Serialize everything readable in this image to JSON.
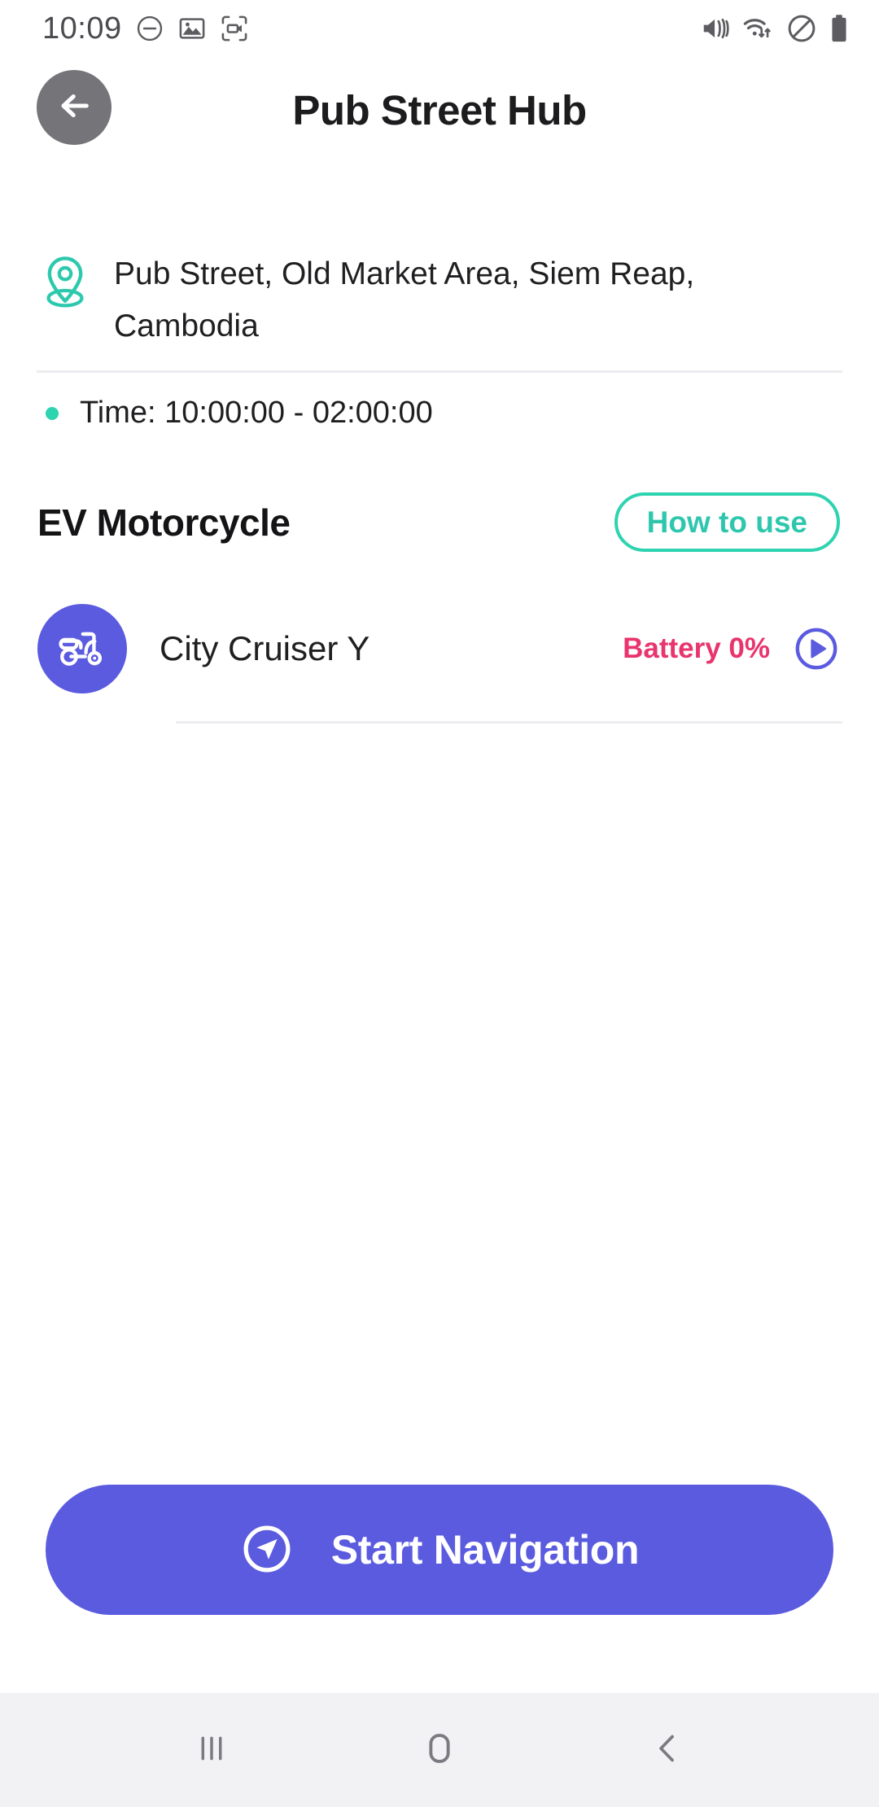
{
  "statusbar": {
    "time": "10:09",
    "left_icons": [
      {
        "name": "do-not-disturb-minus-icon"
      },
      {
        "name": "image-gallery-icon"
      },
      {
        "name": "screen-recorder-icon"
      }
    ],
    "right_icons": [
      {
        "name": "sound-vibrate-mute-icon"
      },
      {
        "name": "wifi-data-transfer-icon"
      },
      {
        "name": "do-not-disturb-icon"
      },
      {
        "name": "battery-icon"
      }
    ]
  },
  "header": {
    "title": "Pub Street Hub",
    "back_icon": "arrow-left-icon"
  },
  "location": {
    "pin_icon": "map-pin-icon",
    "address": "Pub Street, Old Market Area, Siem Reap, Cambodia",
    "time_label": "Time: 10:00:00 - 02:00:00"
  },
  "section": {
    "title": "EV Motorcycle",
    "how_to_use_label": "How to use"
  },
  "vehicles": [
    {
      "icon": "scooter-icon",
      "name": "City Cruiser Y",
      "battery_label": "Battery 0%",
      "battery_percent": 0,
      "play_icon": "play-circle-icon"
    }
  ],
  "cta": {
    "label": "Start Navigation",
    "icon": "navigation-arrow-icon"
  },
  "navbar": {
    "recents_icon": "recents-icon",
    "home_icon": "home-icon",
    "back_icon": "back-chevron-icon"
  },
  "colors": {
    "accent_teal": "#2ed3b0",
    "accent_purple": "#5b5be0",
    "battery_pink": "#e8356d",
    "text_dark": "#1f1f21",
    "divider": "#ededf1",
    "navbar_bg": "#f2f2f4"
  }
}
